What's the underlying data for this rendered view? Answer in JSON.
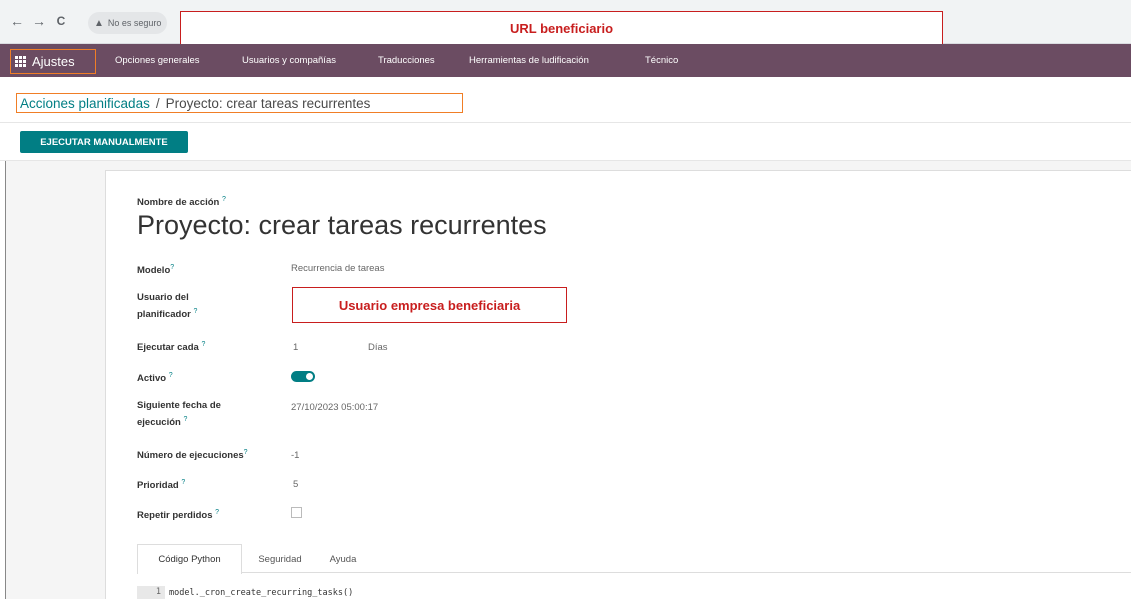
{
  "browser": {
    "back_icon": "←",
    "forward_icon": "→",
    "reload_icon": "C",
    "security_label": "No es seguro",
    "url_annotation": "URL beneficiario"
  },
  "nav": {
    "app_name": "Ajustes",
    "items": [
      "Opciones generales",
      "Usuarios y compañías",
      "Traducciones",
      "Herramientas de ludificación",
      "Técnico"
    ]
  },
  "breadcrumb": {
    "parent": "Acciones planificadas",
    "separator": "/",
    "current": "Proyecto: crear tareas recurrentes"
  },
  "actions": {
    "run_manually": "EJECUTAR MANUALMENTE"
  },
  "form": {
    "action_name_label": "Nombre de acción",
    "title": "Proyecto: crear tareas recurrentes",
    "model_label": "Modelo",
    "model_value": "Recurrencia de tareas",
    "scheduler_user_label_1": "Usuario del",
    "scheduler_user_label_2": "planificador",
    "scheduler_user_annotation": "Usuario empresa beneficiaria",
    "interval_label": "Ejecutar cada",
    "interval_number": "1",
    "interval_unit": "Días",
    "active_label": "Activo",
    "active": true,
    "next_exec_label_1": "Siguiente fecha de",
    "next_exec_label_2": "ejecución",
    "next_exec_value": "27/10/2023 05:00:17",
    "num_calls_label": "Número de ejecuciones",
    "num_calls_value": "-1",
    "priority_label": "Prioridad",
    "priority_value": "5",
    "repeat_missed_label": "Repetir perdidos",
    "repeat_missed": false,
    "help_marker": "?"
  },
  "tabs": [
    {
      "label": "Código Python",
      "active": true
    },
    {
      "label": "Seguridad",
      "active": false
    },
    {
      "label": "Ayuda",
      "active": false
    }
  ],
  "code": {
    "line_number": "1",
    "line": "model._cron_create_recurring_tasks()"
  },
  "colors": {
    "navbar": "#6b4c62",
    "primary": "#017e84",
    "annotation_red": "#c81e1e",
    "annotation_orange": "#f07e26"
  }
}
